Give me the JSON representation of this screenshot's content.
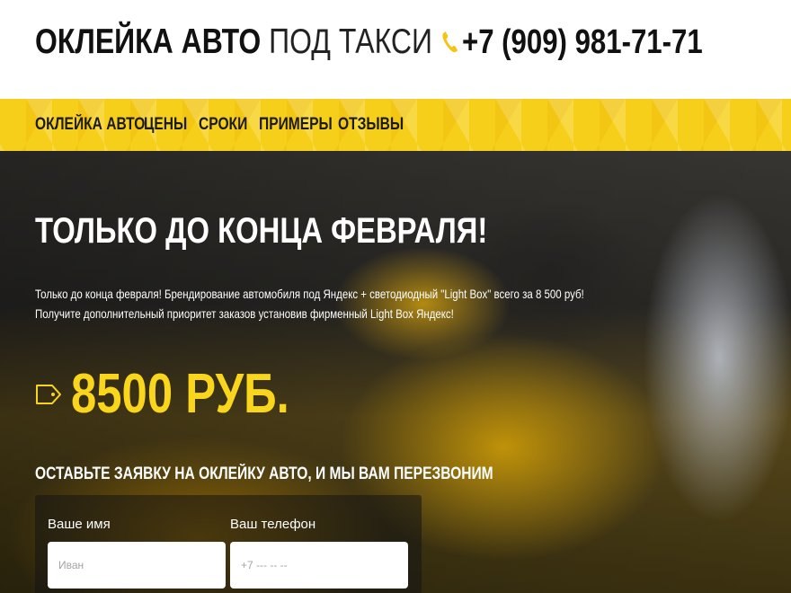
{
  "header": {
    "logo_bold": "ОКЛЕЙКА АВТО",
    "logo_light": "ПОД ТАКСИ",
    "phone": "+7 (909) 981-71-71",
    "phone_icon": "phone-icon",
    "accent_color": "#f6cf1a"
  },
  "nav": {
    "items": [
      {
        "label": "ОКЛЕЙКА АВТО"
      },
      {
        "label": "ЦЕНЫ"
      },
      {
        "label": "СРОКИ"
      },
      {
        "label": "ПРИМЕРЫ"
      },
      {
        "label": "ОТЗЫВЫ"
      }
    ]
  },
  "hero": {
    "title": "ТОЛЬКО ДО КОНЦА ФЕВРАЛЯ!",
    "text_line1": "Только до конца февраля! Брендирование автомобиля под Яндекс + светодиодный \"Light Box\" всего за 8 500 руб!",
    "text_line2": "Получите дополнительный приоритет заказов установив фирменный Light Box Яндекс!",
    "price": "8500 РУБ.",
    "price_icon": "price-tag-icon",
    "price_color": "#f9d51c"
  },
  "form": {
    "heading": "ОСТАВЬТЕ ЗАЯВКУ НА ОКЛЕЙКУ АВТО, И МЫ ВАМ ПЕРЕЗВОНИМ",
    "name_label": "Ваше имя",
    "name_placeholder": "Иван",
    "phone_label": "Ваш телефон",
    "phone_placeholder": "+7 --- -- --"
  }
}
